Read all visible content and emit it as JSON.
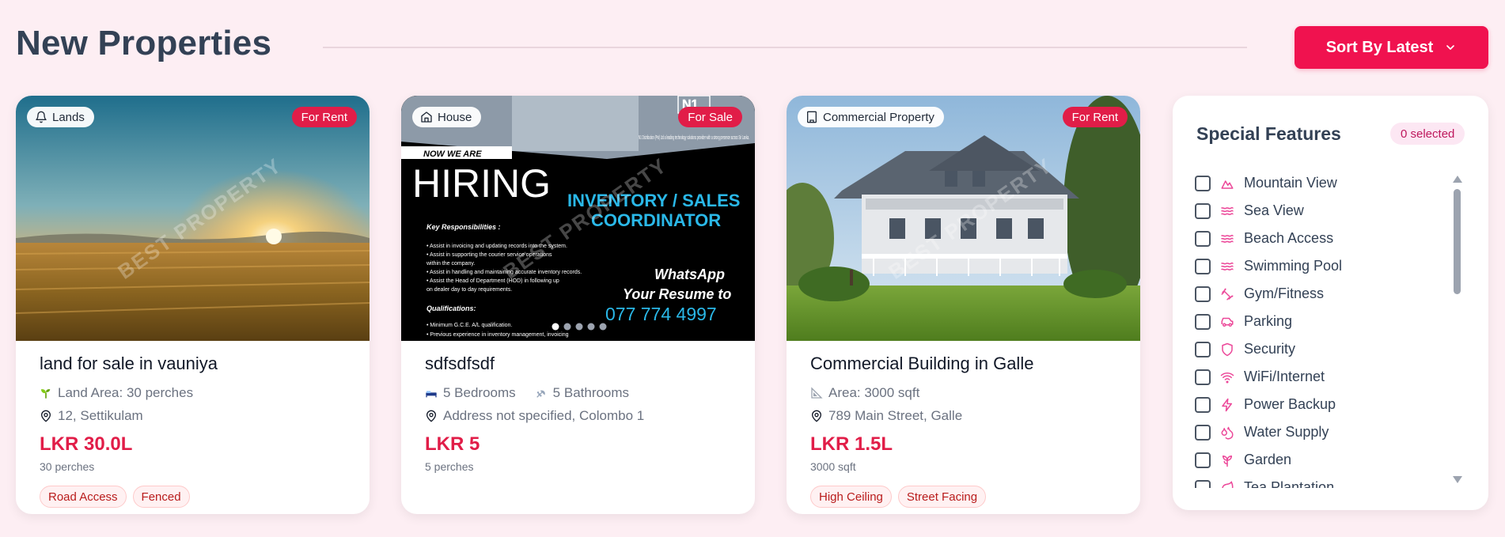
{
  "header": {
    "title": "New Properties",
    "sort_label": "Sort By Latest"
  },
  "colors": {
    "accent": "#f0124f",
    "price": "#e11d48",
    "background": "#fdeef3",
    "feature_icon": "#ec4899"
  },
  "cards": [
    {
      "type_label": "Lands",
      "type_icon": "bell-icon",
      "status": "For Rent",
      "watermark": "BEST PROPERTY",
      "image": "sunset-field",
      "title": "land for sale in vauniya",
      "meta": [
        {
          "icon": "sprout-icon",
          "text": "Land Area: 30 perches"
        }
      ],
      "location": "12, Settikulam",
      "price": "LKR 30.0L",
      "sub": "30 perches",
      "tags": [
        "Road Access",
        "Fenced"
      ]
    },
    {
      "type_label": "House",
      "type_icon": "home-icon",
      "status": "For Sale",
      "watermark": "BEST PROPERTY",
      "image": "hiring-poster",
      "title": "sdfsdfsdf",
      "meta": [
        {
          "icon": "bed-icon",
          "text": "5 Bedrooms"
        },
        {
          "icon": "shower-icon",
          "text": "5 Bathrooms"
        }
      ],
      "location": "Address not specified, Colombo 1",
      "price": "LKR 5",
      "sub": "5 perches",
      "tags": [],
      "poster": {
        "logo": "N1",
        "intro": "N1 Distribution (Pvt) Ltd a leading technology solutions provider with a strong presence across Sri Lanka.",
        "now": "NOW WE ARE",
        "hiring": "HIRING",
        "role_line1": "INVENTORY / SALES",
        "role_line2": "COORDINATOR",
        "resp_title": "Key Responsibilities :",
        "resp": [
          "• Assist in invoicing and updating records into the system.",
          "• Assist in supporting the courier service operations",
          "   within the company.",
          "• Assist in handling and maintaining accurate inventory records.",
          "• Assist the Head of Department (HOD) in following up",
          "   on dealer day to day requirements."
        ],
        "qual_title": "Qualifications:",
        "qual": [
          "• Minimum G.C.E. A/L qualification.",
          "• Previous experience in inventory management, invoicing"
        ],
        "whatsapp_line1": "WhatsApp",
        "whatsapp_line2": "Your Resume to",
        "phone": "077 774 4997",
        "slide_count": 5,
        "active_slide": 1
      }
    },
    {
      "type_label": "Commercial Property",
      "type_icon": "building-icon",
      "status": "For Rent",
      "watermark": "BEST PROPERTY",
      "image": "white-house",
      "title": "Commercial Building in Galle",
      "meta": [
        {
          "icon": "ruler-icon",
          "text": "Area: 3000 sqft"
        }
      ],
      "location": "789 Main Street, Galle",
      "price": "LKR 1.5L",
      "sub": "3000 sqft",
      "tags": [
        "High Ceiling",
        "Street Facing"
      ]
    }
  ],
  "features": {
    "title": "Special Features",
    "selected_text": "0 selected",
    "items": [
      {
        "label": "Mountain View",
        "icon": "mountain-icon",
        "checked": false
      },
      {
        "label": "Sea View",
        "icon": "waves-icon",
        "checked": false
      },
      {
        "label": "Beach Access",
        "icon": "waves-icon",
        "checked": false
      },
      {
        "label": "Swimming Pool",
        "icon": "waves-icon",
        "checked": false
      },
      {
        "label": "Gym/Fitness",
        "icon": "dumbbell-icon",
        "checked": false
      },
      {
        "label": "Parking",
        "icon": "car-icon",
        "checked": false
      },
      {
        "label": "Security",
        "icon": "shield-icon",
        "checked": false
      },
      {
        "label": "WiFi/Internet",
        "icon": "wifi-icon",
        "checked": false
      },
      {
        "label": "Power Backup",
        "icon": "zap-icon",
        "checked": false
      },
      {
        "label": "Water Supply",
        "icon": "droplets-icon",
        "checked": false
      },
      {
        "label": "Garden",
        "icon": "flower-icon",
        "checked": false
      },
      {
        "label": "Tea Plantation",
        "icon": "leaf-icon",
        "checked": false
      }
    ]
  }
}
